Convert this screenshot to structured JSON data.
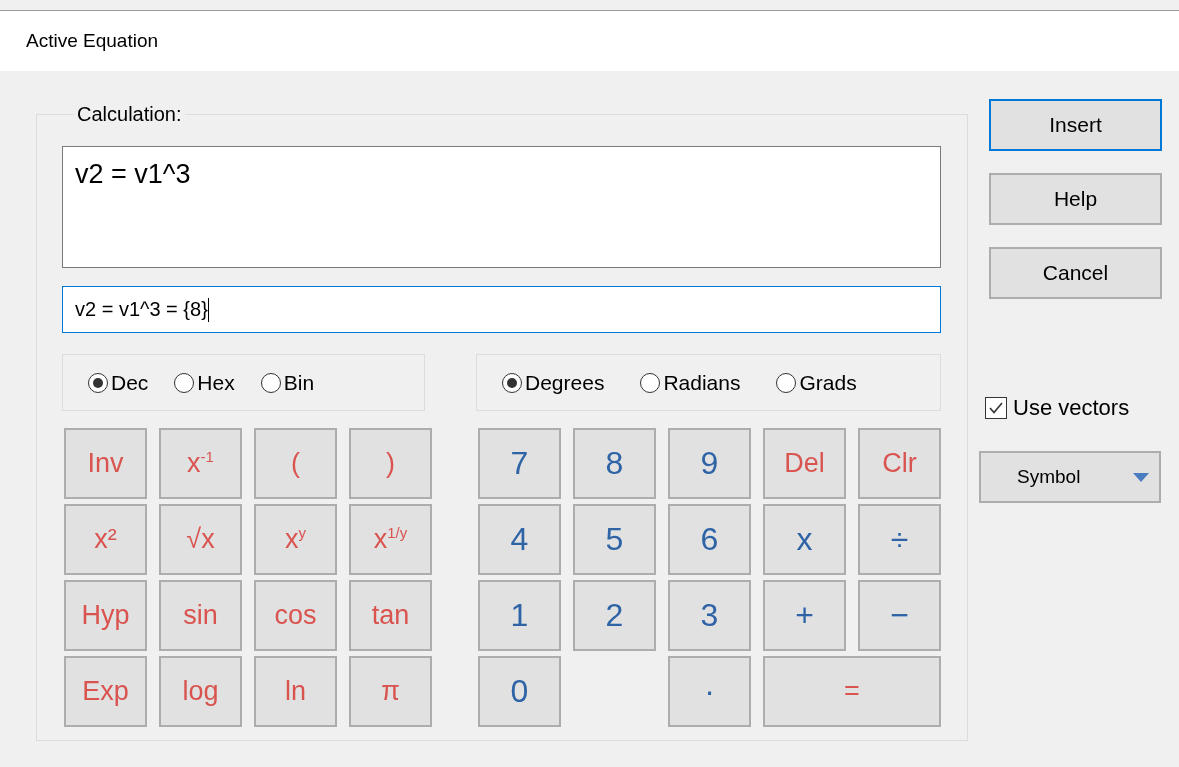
{
  "window": {
    "title": "Active Equation"
  },
  "calculation": {
    "label": "Calculation:",
    "expression": "v2 = v1^3",
    "result": "v2 = v1^3 = {8}"
  },
  "number_base": [
    {
      "label": "Dec",
      "selected": true
    },
    {
      "label": "Hex",
      "selected": false
    },
    {
      "label": "Bin",
      "selected": false
    }
  ],
  "angle_unit": [
    {
      "label": "Degrees",
      "selected": true
    },
    {
      "label": "Radians",
      "selected": false
    },
    {
      "label": "Grads",
      "selected": false
    }
  ],
  "function_keys": [
    [
      {
        "label": "Inv",
        "kind": "function"
      },
      {
        "label": "x$^{-1}$",
        "kind": "function"
      },
      {
        "label": "(",
        "kind": "function"
      },
      {
        "label": ")",
        "kind": "function"
      }
    ],
    [
      {
        "label": "x²",
        "kind": "function"
      },
      {
        "label": "√x",
        "kind": "function"
      },
      {
        "label": "x$^{y}$",
        "kind": "function"
      },
      {
        "label": "x$^{1/y}$",
        "kind": "function"
      }
    ],
    [
      {
        "label": "Hyp",
        "kind": "function"
      },
      {
        "label": "sin",
        "kind": "function"
      },
      {
        "label": "cos",
        "kind": "function"
      },
      {
        "label": "tan",
        "kind": "function"
      }
    ],
    [
      {
        "label": "Exp",
        "kind": "function"
      },
      {
        "label": "log",
        "kind": "function"
      },
      {
        "label": "ln",
        "kind": "function"
      },
      {
        "label": "π",
        "kind": "function"
      }
    ]
  ],
  "number_keys": [
    [
      {
        "label": "7",
        "kind": "digit"
      },
      {
        "label": "8",
        "kind": "digit"
      },
      {
        "label": "9",
        "kind": "digit"
      },
      {
        "label": "Del",
        "kind": "function"
      },
      {
        "label": "Clr",
        "kind": "function"
      }
    ],
    [
      {
        "label": "4",
        "kind": "digit"
      },
      {
        "label": "5",
        "kind": "digit"
      },
      {
        "label": "6",
        "kind": "digit"
      },
      {
        "label": "x",
        "kind": "digit"
      },
      {
        "label": "÷",
        "kind": "digit"
      }
    ],
    [
      {
        "label": "1",
        "kind": "digit"
      },
      {
        "label": "2",
        "kind": "digit"
      },
      {
        "label": "3",
        "kind": "digit"
      },
      {
        "label": "+",
        "kind": "digit"
      },
      {
        "label": "−",
        "kind": "digit"
      }
    ],
    [
      {
        "label": "0",
        "kind": "digit"
      },
      {
        "kind": "blank"
      },
      {
        "label": "·",
        "kind": "digit"
      },
      {
        "label": "=",
        "kind": "function",
        "wide": true
      }
    ]
  ],
  "buttons": [
    {
      "label": "Insert",
      "default": true
    },
    {
      "label": "Help",
      "default": false
    },
    {
      "label": "Cancel",
      "default": false
    }
  ],
  "use_vectors": {
    "label": "Use vectors",
    "checked": true
  },
  "symbol_menu": {
    "label": "Symbol"
  }
}
